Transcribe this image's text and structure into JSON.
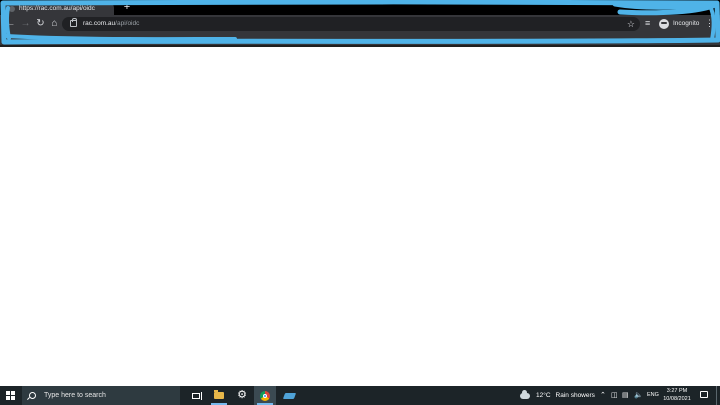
{
  "browser": {
    "tab_title": "https://rac.com.au/api/oidc",
    "new_tab_label": "+",
    "url_host": "rac.com.au",
    "url_path": "/api/oidc",
    "incognito_label": "Incognito"
  },
  "page": {
    "background": "#ffffff"
  },
  "taskbar": {
    "search_placeholder": "Type here to search",
    "weather_temp": "12°C",
    "weather_desc": "Rain showers",
    "language": "ENG",
    "time": "3:27 PM",
    "date": "10/08/2021",
    "icons": [
      "windows-start-icon",
      "search-icon",
      "task-view-icon",
      "file-explorer-icon",
      "settings-gear-icon",
      "chrome-icon",
      "scanner-icon",
      "cloud-icon",
      "chevron-up-icon",
      "network-icon",
      "volume-icon",
      "notification-icon"
    ]
  },
  "colors": {
    "redaction": "#4fb3e8",
    "chrome_dark": "#35363a",
    "taskbar": "#1c2428"
  }
}
